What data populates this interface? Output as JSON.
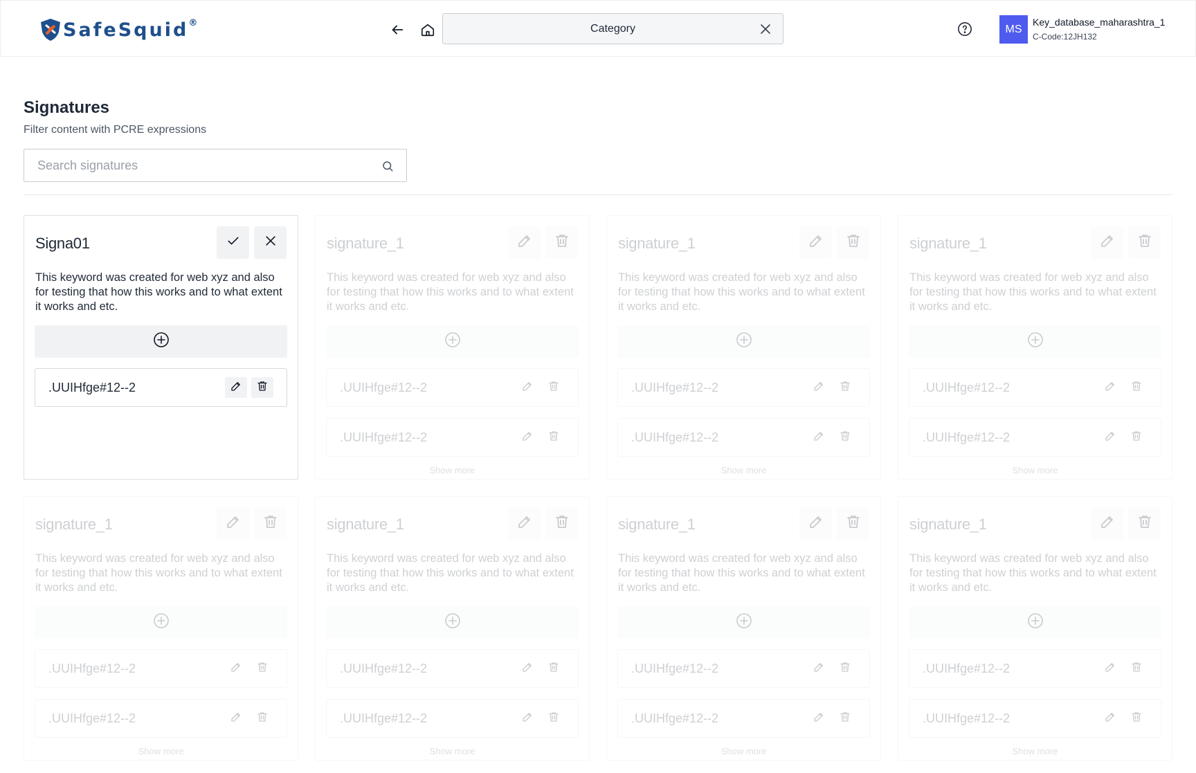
{
  "header": {
    "logo_text": "SafeSquid",
    "logo_mark": "®",
    "category_label": "Category",
    "avatar_initials": "MS",
    "db_name": "Key_database_maharashtra_1",
    "db_code": "C-Code:12JH132"
  },
  "page": {
    "title": "Signatures",
    "subtitle": "Filter content with PCRE expressions",
    "search_placeholder": "Search signatures"
  },
  "colors": {
    "brand": "#1e4f8c",
    "avatar": "#4f5bef"
  },
  "cards": [
    {
      "title": "Signa01",
      "description": "This keyword was created for web xyz and also for testing that how this works and to what extent it works and etc.",
      "state": "editing",
      "rows": [
        ".UUIHfge#12--2"
      ],
      "show_more": ""
    },
    {
      "title": "signature_1",
      "description": "This keyword was created for web xyz and also for testing that how this works and to what extent it works and etc.",
      "state": "disabled",
      "rows": [
        ".UUIHfge#12--2",
        ".UUIHfge#12--2"
      ],
      "show_more": "Show more"
    },
    {
      "title": "signature_1",
      "description": "This keyword was created for web xyz and also for testing that how this works and to what extent it works and etc.",
      "state": "disabled",
      "rows": [
        ".UUIHfge#12--2",
        ".UUIHfge#12--2"
      ],
      "show_more": "Show more"
    },
    {
      "title": "signature_1",
      "description": "This keyword was created for web xyz and also for testing that how this works and to what extent it works and etc.",
      "state": "disabled",
      "rows": [
        ".UUIHfge#12--2",
        ".UUIHfge#12--2"
      ],
      "show_more": "Show more"
    },
    {
      "title": "signature_1",
      "description": "This keyword was created for web xyz and also for testing that how this works and to what extent it works and etc.",
      "state": "disabled",
      "rows": [
        ".UUIHfge#12--2",
        ".UUIHfge#12--2"
      ],
      "show_more": "Show more"
    },
    {
      "title": "signature_1",
      "description": "This keyword was created for web xyz and also for testing that how this works and to what extent it works and etc.",
      "state": "disabled",
      "rows": [
        ".UUIHfge#12--2",
        ".UUIHfge#12--2"
      ],
      "show_more": "Show more"
    },
    {
      "title": "signature_1",
      "description": "This keyword was created for web xyz and also for testing that how this works and to what extent it works and etc.",
      "state": "disabled",
      "rows": [
        ".UUIHfge#12--2",
        ".UUIHfge#12--2"
      ],
      "show_more": "Show more"
    },
    {
      "title": "signature_1",
      "description": "This keyword was created for web xyz and also for testing that how this works and to what extent it works and etc.",
      "state": "disabled",
      "rows": [
        ".UUIHfge#12--2",
        ".UUIHfge#12--2"
      ],
      "show_more": "Show more"
    }
  ]
}
